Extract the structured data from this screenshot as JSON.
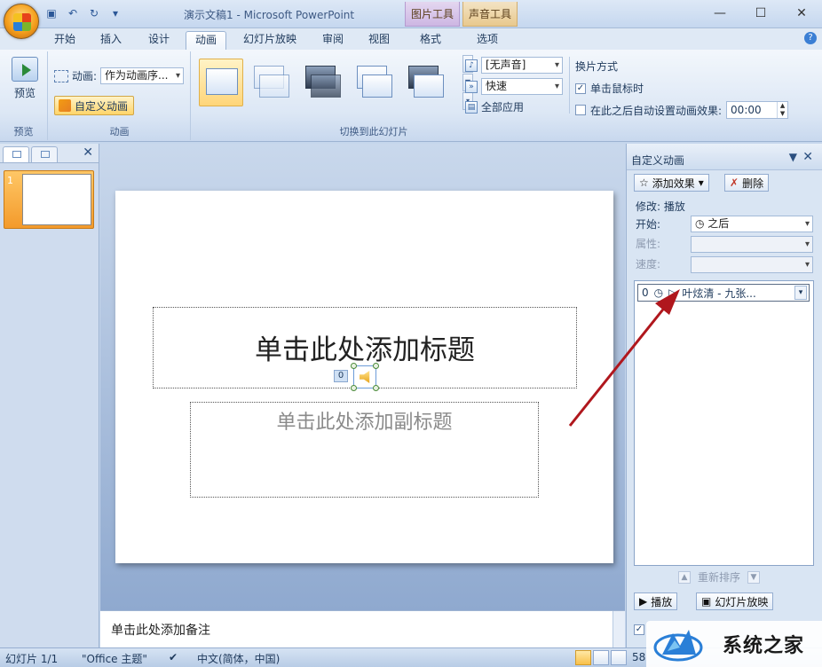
{
  "window": {
    "title": "演示文稿1 - Microsoft PowerPoint",
    "context_tab_picture": "图片工具",
    "context_tab_sound": "声音工具",
    "min": "—",
    "max": "☐",
    "close": "✕"
  },
  "tabs": [
    "开始",
    "插入",
    "设计",
    "动画",
    "幻灯片放映",
    "审阅",
    "视图",
    "格式",
    "选项"
  ],
  "ribbon": {
    "preview_label": "预览",
    "preview_group": "预览",
    "animation_label": "动画:",
    "animation_value": "作为动画序...",
    "custom_animation": "自定义动画",
    "animation_group": "动画",
    "sound_value": "[无声音]",
    "speed_value": "快速",
    "apply_all": "全部应用",
    "transition_group": "切换到此幻灯片",
    "advance_title": "换片方式",
    "on_click": "单击鼠标时",
    "auto_after": "在此之后自动设置动画效果:",
    "auto_time": "00:00"
  },
  "slide_pane": {
    "slide_number": "1"
  },
  "slide": {
    "title_placeholder": "单击此处添加标题",
    "subtitle_placeholder": "单击此处添加副标题",
    "anim_tag": "0"
  },
  "notes": {
    "placeholder": "单击此处添加备注"
  },
  "task_pane": {
    "title": "自定义动画",
    "add_effect": "添加效果",
    "remove": "删除",
    "modify": "修改: 播放",
    "start_label": "开始:",
    "start_value": "之后",
    "property_label": "属性:",
    "speed_label": "速度:",
    "item_index": "0",
    "item_text": "叶炫清 - 九张...",
    "reorder": "重新排序",
    "play": "播放",
    "slideshow": "幻灯片放映"
  },
  "status": {
    "slide": "幻灯片 1/1",
    "theme": "\"Office 主题\"",
    "lang": "中文(简体，中国)",
    "zoom": "58"
  },
  "watermark": {
    "text": "系统之家"
  },
  "colors": {
    "arrow": "#b0171d",
    "accent": "#f39a2b"
  }
}
